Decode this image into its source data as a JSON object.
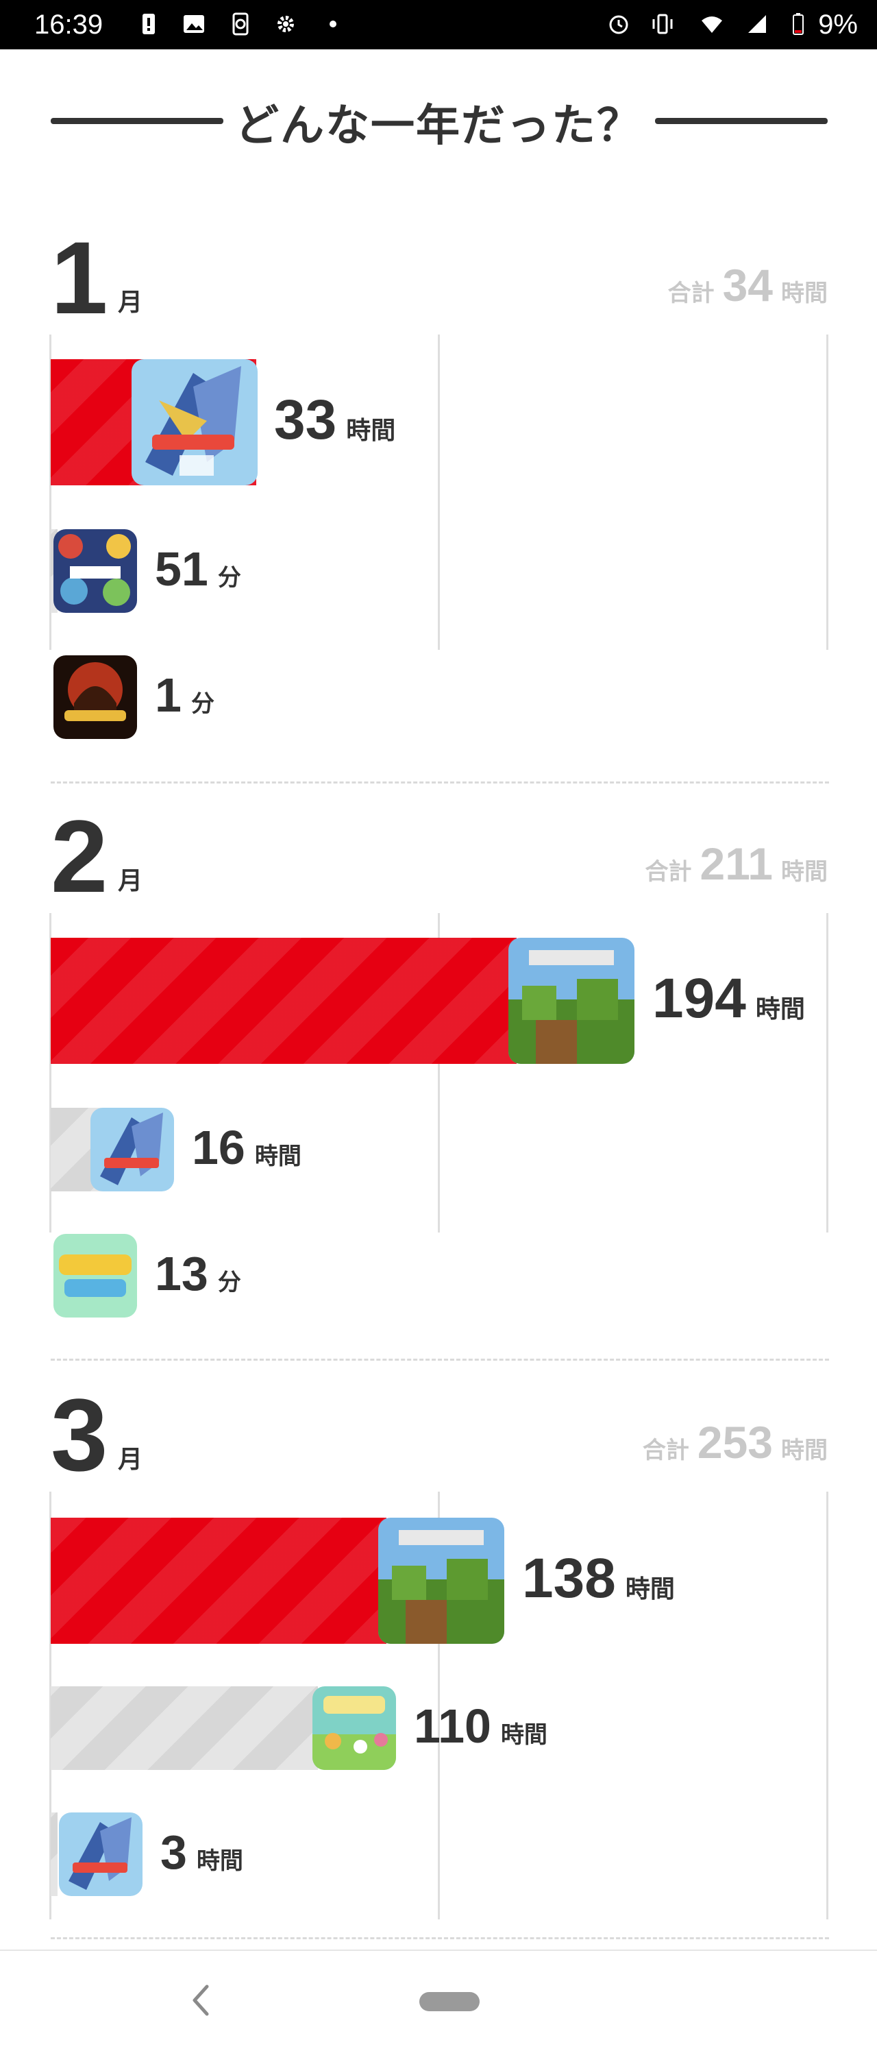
{
  "status_bar": {
    "time": "16:39",
    "battery": "9%"
  },
  "header": {
    "title": "どんな一年だった？"
  },
  "months": [
    {
      "month": "1",
      "unit": "月",
      "total_label": "合計",
      "total_value": "34",
      "total_unit": "時間",
      "entries": [
        {
          "game": "pokemon-sword",
          "value": "33",
          "unit": "時間",
          "highlight": true
        },
        {
          "game": "smash-bros",
          "value": "51",
          "unit": "分",
          "highlight": false
        },
        {
          "game": "winning-post-9",
          "value": "1",
          "unit": "分",
          "highlight": false
        }
      ]
    },
    {
      "month": "2",
      "unit": "月",
      "total_label": "合計",
      "total_value": "211",
      "total_unit": "時間",
      "entries": [
        {
          "game": "minecraft",
          "value": "194",
          "unit": "時間",
          "highlight": true
        },
        {
          "game": "pokemon-sword",
          "value": "16",
          "unit": "時間",
          "highlight": false
        },
        {
          "game": "pokemon-home",
          "value": "13",
          "unit": "分",
          "highlight": false
        }
      ]
    },
    {
      "month": "3",
      "unit": "月",
      "total_label": "合計",
      "total_value": "253",
      "total_unit": "時間",
      "entries": [
        {
          "game": "minecraft",
          "value": "138",
          "unit": "時間",
          "highlight": true
        },
        {
          "game": "animal-crossing",
          "value": "110",
          "unit": "時間",
          "highlight": false
        },
        {
          "game": "pokemon-sword",
          "value": "3",
          "unit": "時間",
          "highlight": false
        }
      ]
    }
  ],
  "colors": {
    "accent": "#e60012",
    "bar_gray": "#d7d7d7",
    "text": "#333333",
    "muted": "#c8c8c8"
  },
  "icons": [
    "alarm-icon",
    "vibrate-icon",
    "wifi-icon",
    "signal-icon",
    "battery-icon",
    "back-icon",
    "home-pill-icon"
  ]
}
